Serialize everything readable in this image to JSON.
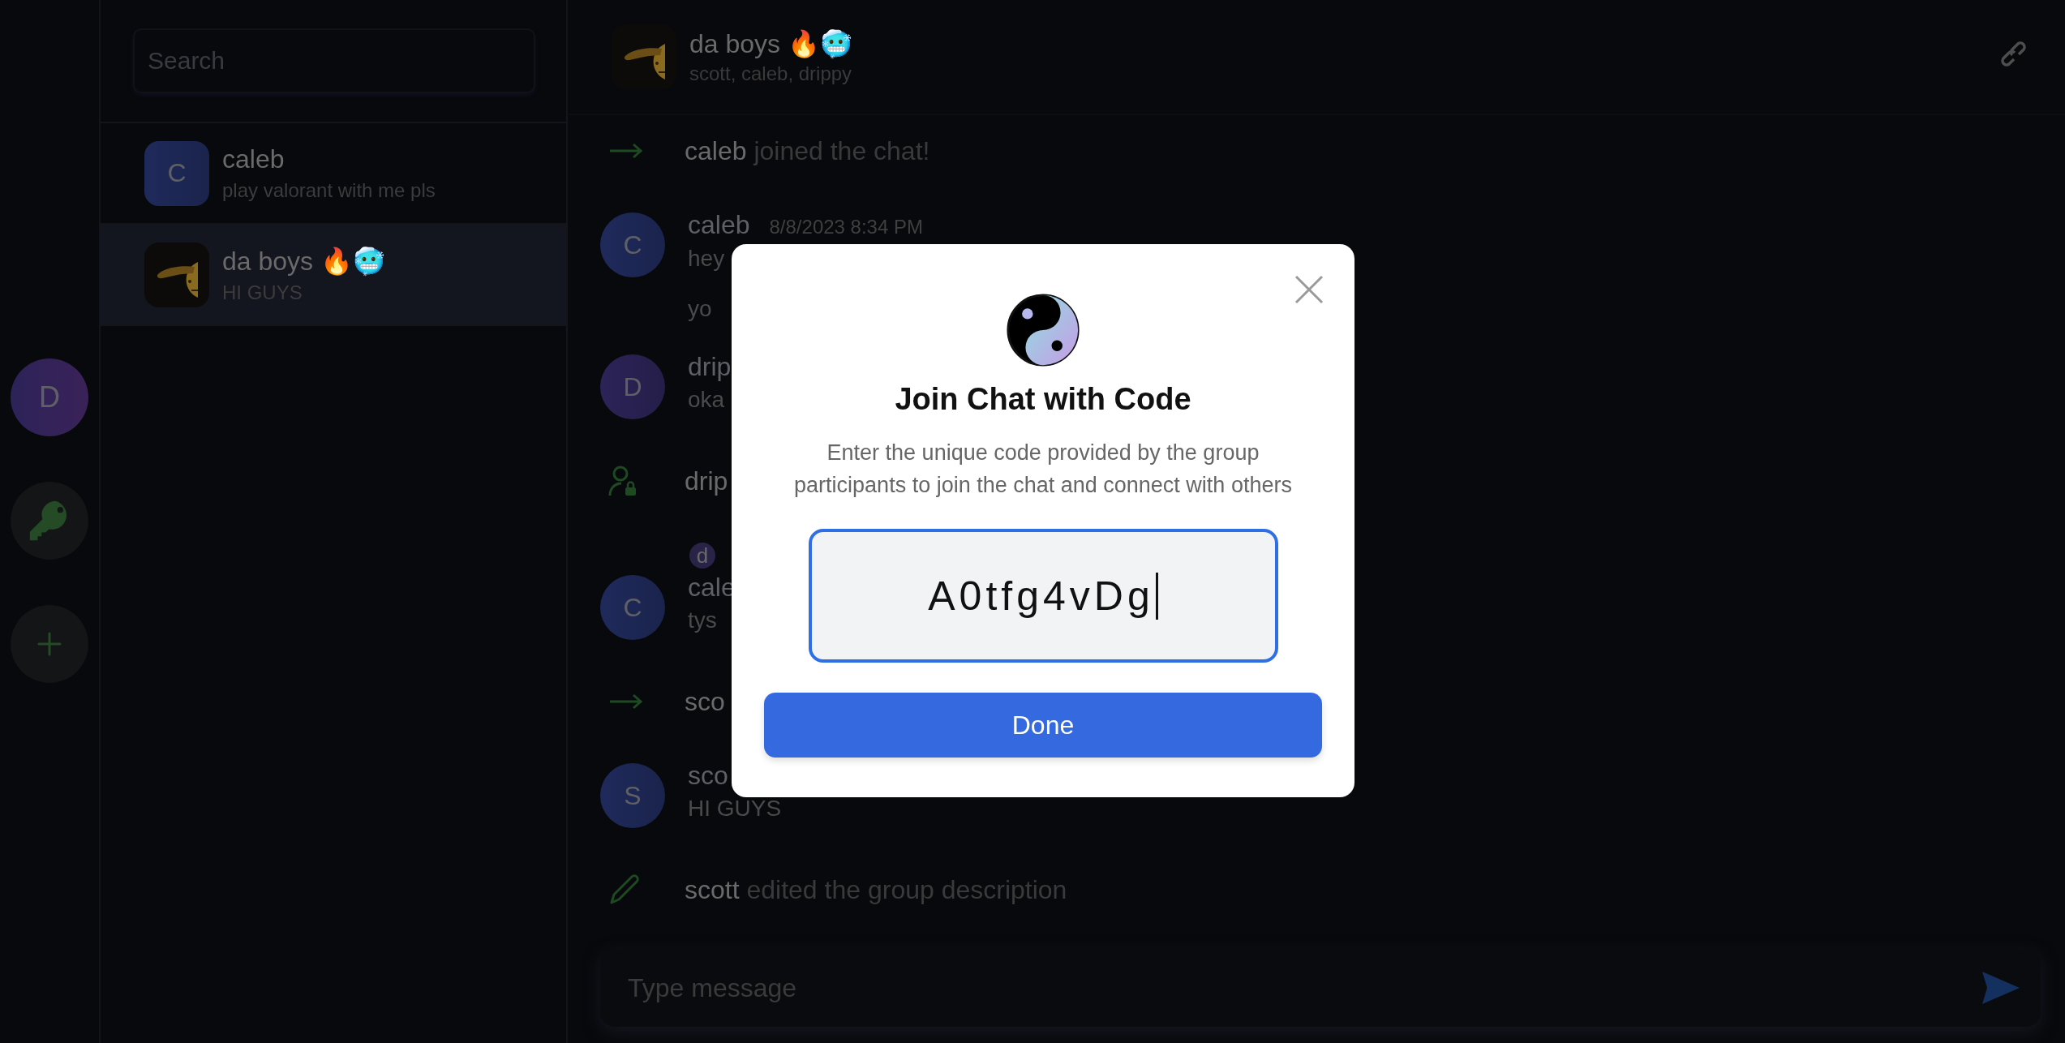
{
  "rail": {
    "items": [
      {
        "kind": "avatar",
        "letter": "D",
        "color": "#2c2358"
      },
      {
        "kind": "key"
      },
      {
        "kind": "add"
      }
    ]
  },
  "sidebar": {
    "search": {
      "placeholder": "Search"
    },
    "chats": [
      {
        "name": "caleb",
        "preview": "play valorant with me pls",
        "avatar": {
          "kind": "letter",
          "letter": "C",
          "color": "#1f2a5c"
        },
        "selected": false
      },
      {
        "name": "da boys 🔥🥶",
        "preview": "HI GUYS",
        "avatar": {
          "kind": "emoji"
        },
        "selected": true
      }
    ]
  },
  "chat": {
    "header": {
      "name": "da boys 🔥🥶",
      "members": "scott, caleb, drippy"
    },
    "timeline": [
      {
        "kind": "join",
        "actor": "caleb",
        "text": "joined the chat!"
      },
      {
        "kind": "message",
        "avatar": {
          "letter": "C",
          "color": "#1f2a5c"
        },
        "name": "caleb",
        "time": "8/8/2023 8:34 PM",
        "lines": [
          "hey",
          "yo"
        ]
      },
      {
        "kind": "message",
        "avatar": {
          "letter": "D",
          "color": "#2c2358"
        },
        "name": "drip",
        "lines": [
          "oka"
        ]
      },
      {
        "kind": "permission",
        "actor": "drip"
      },
      {
        "kind": "message",
        "reaction": "d",
        "avatar": {
          "letter": "C",
          "color": "#1f2a5c"
        },
        "name": "cale",
        "lines": [
          "tys"
        ]
      },
      {
        "kind": "join",
        "actor": "sco"
      },
      {
        "kind": "message",
        "avatar": {
          "letter": "S",
          "color": "#1f2a5c"
        },
        "name": "sco",
        "lines": [
          "HI GUYS"
        ]
      },
      {
        "kind": "edit",
        "actor": "scott",
        "text": "edited the group description"
      }
    ],
    "composer": {
      "placeholder": "Type message"
    }
  },
  "modal": {
    "title": "Join Chat with Code",
    "description": "Enter the unique code provided by the group participants to join the chat and connect with others",
    "code": "A0tfg4vDg",
    "button": "Done"
  }
}
